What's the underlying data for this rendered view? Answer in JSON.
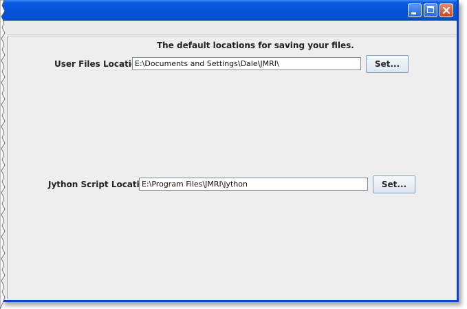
{
  "window": {
    "controls": {
      "minimize_icon": "minimize-icon",
      "maximize_icon": "maximize-icon",
      "close_icon": "close-icon"
    }
  },
  "panel": {
    "heading": "The default locations for saving your files.",
    "user_files": {
      "label": "User Files Location",
      "value": "E:\\Documents and Settings\\Dale\\JMRI\\",
      "button": "Set..."
    },
    "jython": {
      "label": "Jython Script Location",
      "value": "E:\\Program Files\\JMRI\\jython",
      "button": "Set..."
    }
  },
  "colors": {
    "titlebar": "#0452d8",
    "background": "#eeeeee",
    "close_button": "#c9431f"
  }
}
